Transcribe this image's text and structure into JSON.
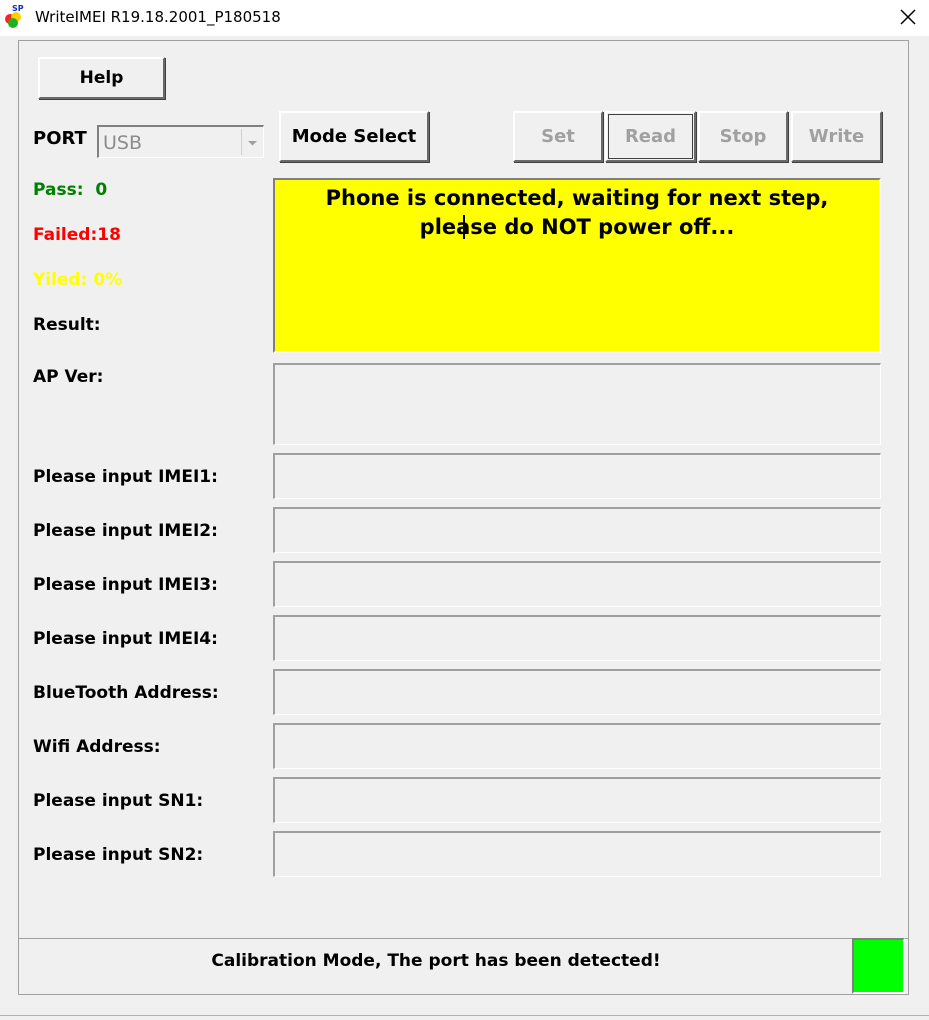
{
  "window": {
    "title": "WriteIMEI R19.18.2001_P180518",
    "icon_badge": "SP"
  },
  "toolbar": {
    "help_label": "Help",
    "port_label": "PORT",
    "port_value": "USB",
    "mode_select_label": "Mode Select",
    "set_label": "Set",
    "read_label": "Read",
    "stop_label": "Stop",
    "write_label": "Write"
  },
  "stats": {
    "pass": "Pass:  0",
    "failed": "Failed:18",
    "yield": "Yiled: 0%",
    "result": "Result:",
    "pass_color": "#008000",
    "failed_color": "#ff0000",
    "yield_color": "#ffff00"
  },
  "status_message": "Phone is connected, waiting for next step, please do NOT power off...",
  "status_color": "#ffff00",
  "ap_ver_label": "AP Ver:",
  "fields": {
    "imei1_label": "Please input IMEI1:",
    "imei2_label": "Please input IMEI2:",
    "imei3_label": "Please input IMEI3:",
    "imei4_label": "Please input IMEI4:",
    "bt_label": "BlueTooth Address:",
    "wifi_label": "Wifi Address:",
    "sn1_label": "Please input SN1:",
    "sn2_label": "Please input SN2:"
  },
  "statusbar": {
    "message": "Calibration Mode, The port has been detected!",
    "indicator_color": "#00ff00"
  }
}
